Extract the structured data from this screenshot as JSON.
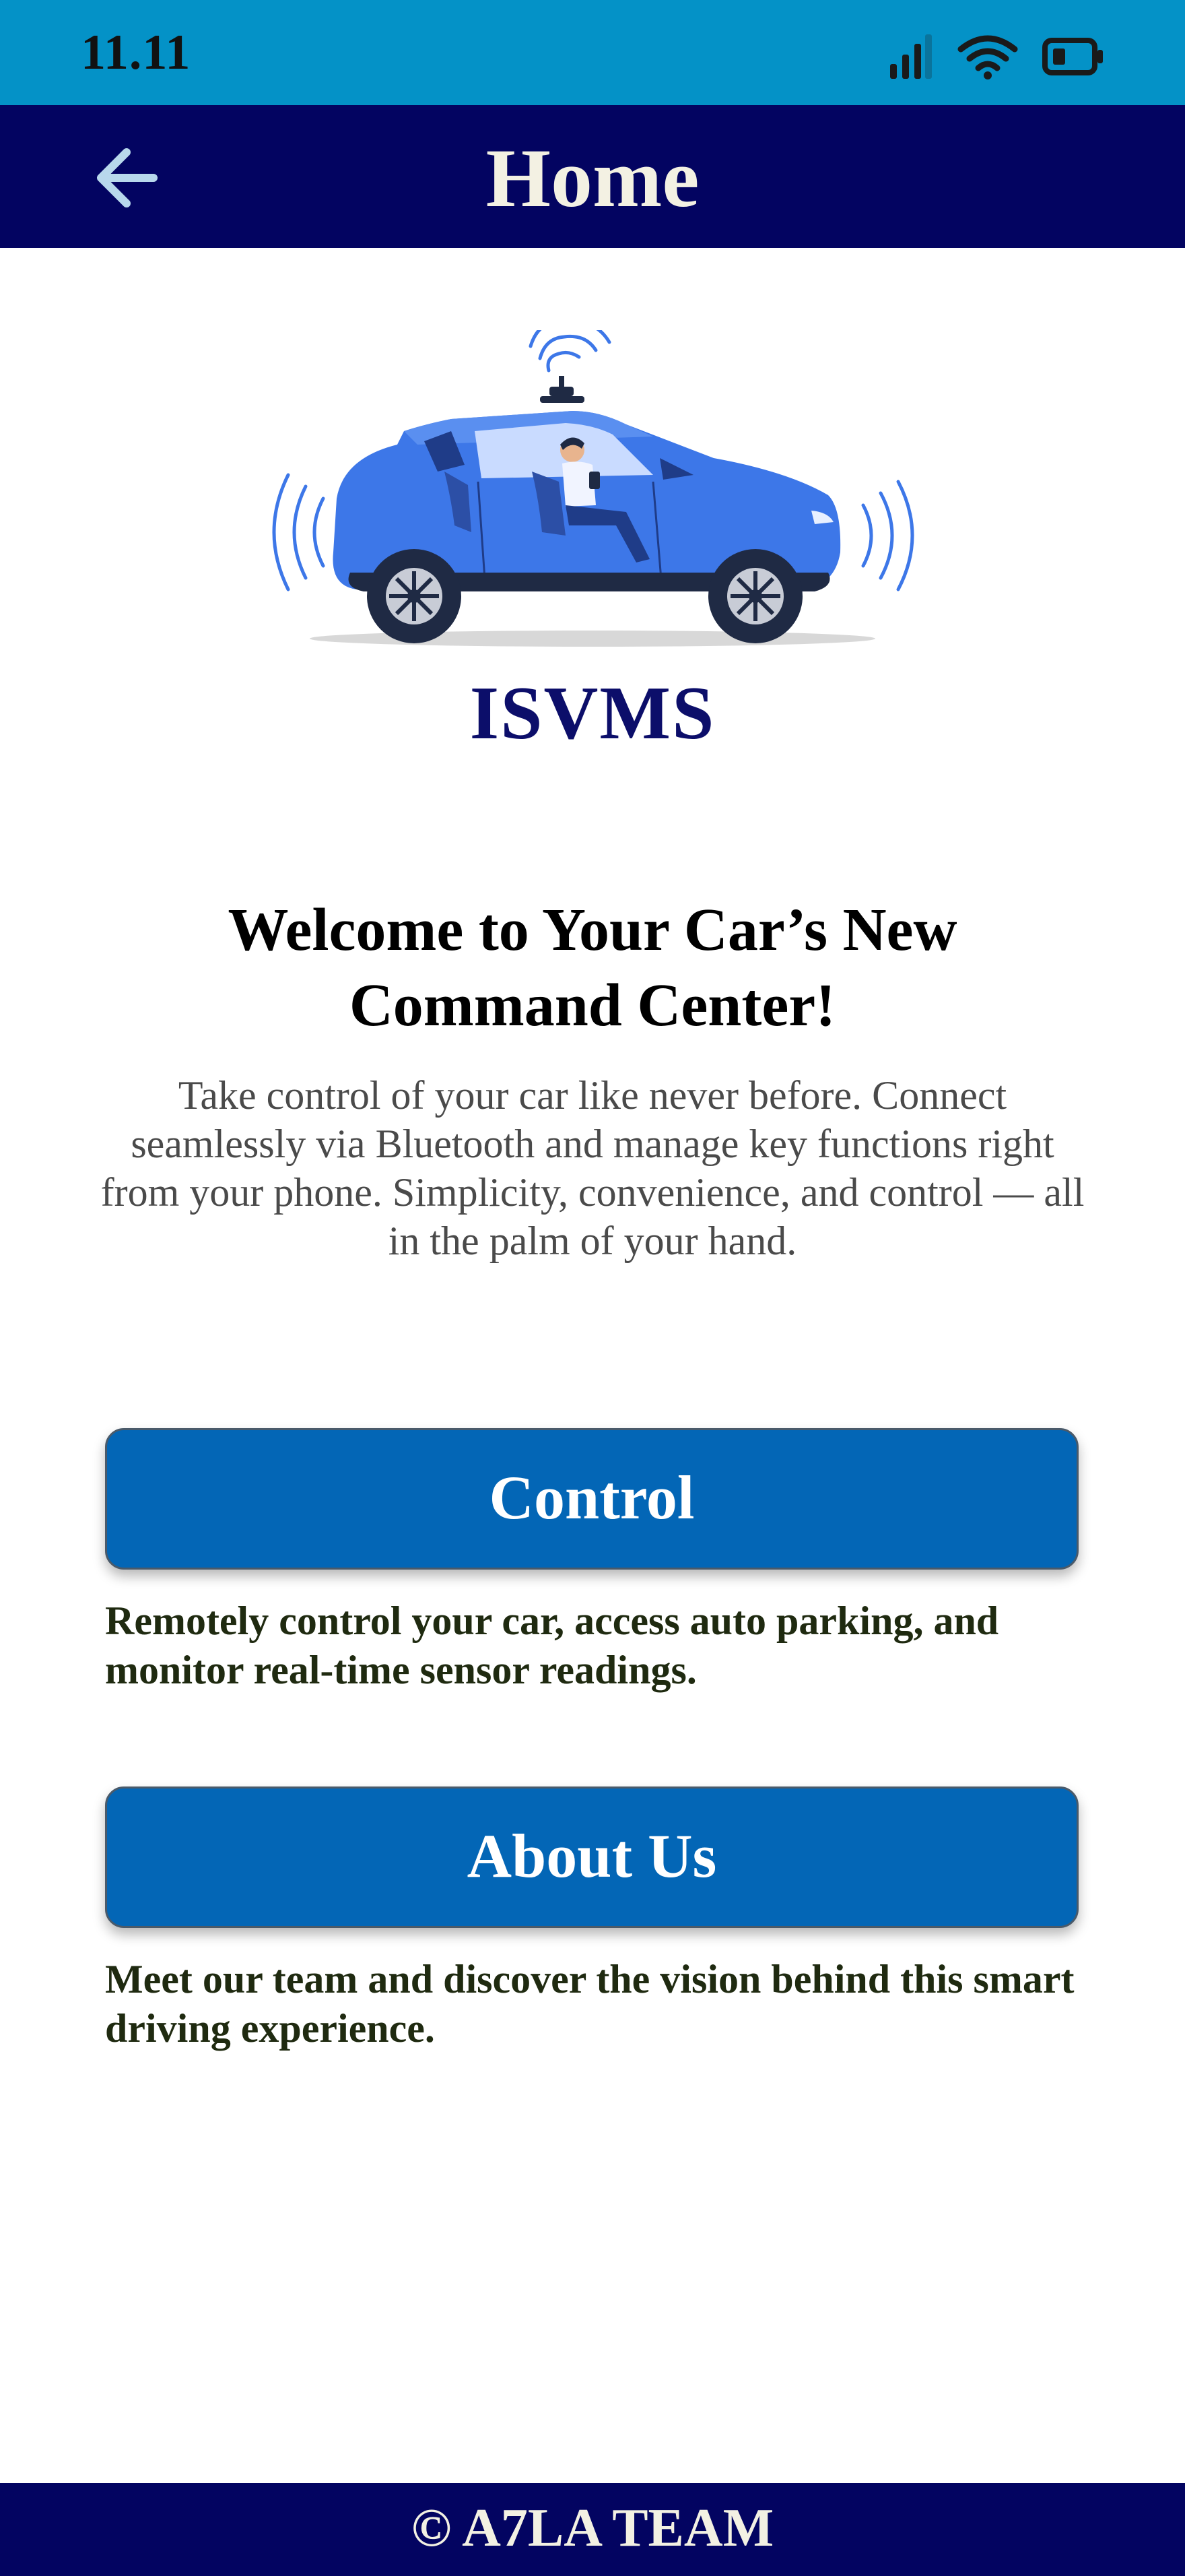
{
  "status_bar": {
    "time": "11.11",
    "icons": [
      "cellular-signal-icon",
      "wifi-icon",
      "battery-icon"
    ]
  },
  "app_bar": {
    "title": "Home",
    "back_icon": "arrow-left-icon"
  },
  "hero": {
    "illustration": "autonomous-car-illustration",
    "brand": "ISVMS"
  },
  "welcome": {
    "heading": "Welcome to Your Car’s New Command Center!",
    "body": "Take control of your car like never before. Connect seamlessly via Bluetooth and manage key functions right from your phone. Simplicity, convenience, and control — all in the palm of your hand."
  },
  "actions": {
    "control": {
      "label": "Control",
      "description": "Remotely control your car, access auto parking, and monitor real-time sensor readings."
    },
    "about": {
      "label": "About Us",
      "description": "Meet our team and discover the vision behind this smart driving experience."
    }
  },
  "footer": {
    "text": "© A7LA TEAM"
  },
  "colors": {
    "status_bar": "#0492C7",
    "app_bar": "#030461",
    "button": "#0366B6",
    "brand": "#0C0E6A",
    "car_body": "#3D77E8"
  }
}
